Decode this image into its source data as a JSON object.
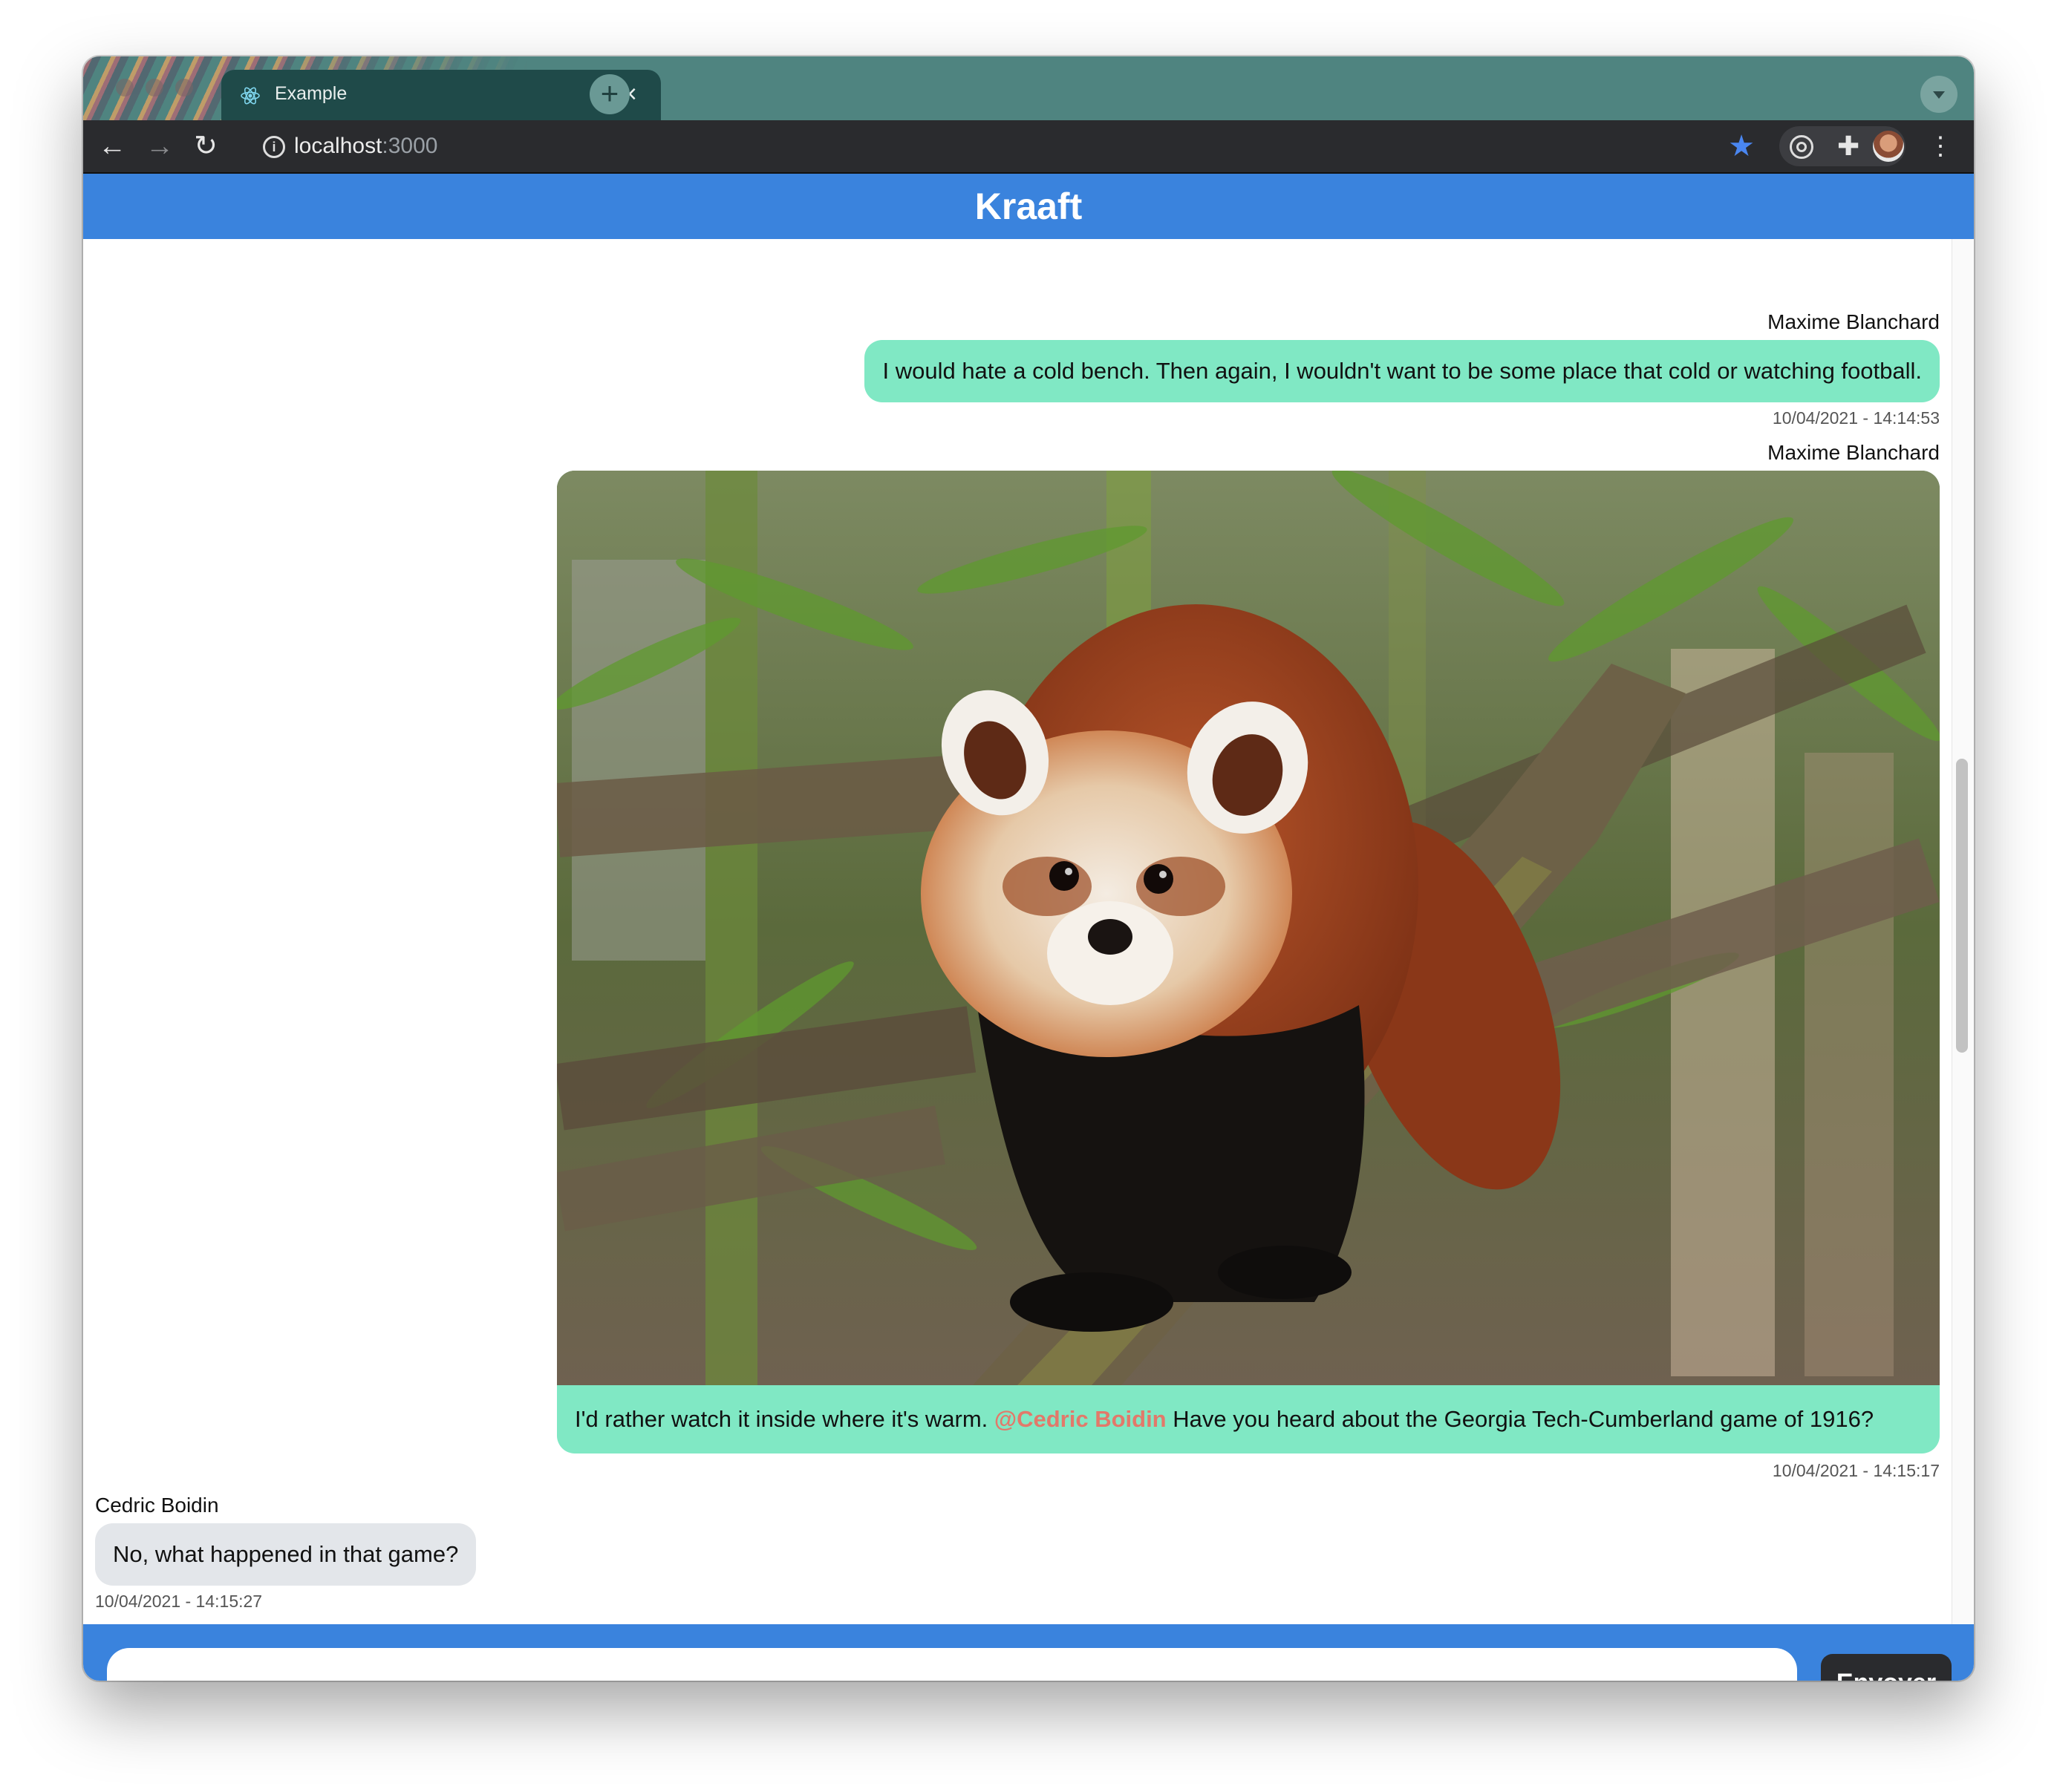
{
  "browser": {
    "tab_title": "Example",
    "url_host": "localhost",
    "url_port": ":3000"
  },
  "app": {
    "title": "Kraaft"
  },
  "messages": [
    {
      "author": "Maxime Blanchard",
      "text": "I would hate a cold bench. Then again, I wouldn't want to be some place that cold or watching football.",
      "time": "10/04/2021 - 14:14:53",
      "side": "right"
    },
    {
      "author": "Maxime Blanchard",
      "image": "red-panda-photo",
      "text_before": "I'd rather watch it inside where it's warm. ",
      "mention": "@Cedric Boidin",
      "text_after": " Have you heard about the Georgia Tech-Cumberland game of 1916?",
      "time": "10/04/2021 - 14:15:17",
      "side": "right"
    },
    {
      "author": "Cedric Boidin",
      "text": "No, what happened in that game?",
      "time": "10/04/2021 - 14:15:27",
      "side": "left"
    }
  ],
  "composer": {
    "placeholder": "",
    "send_label": "Envoyer"
  },
  "colors": {
    "header": "#3a83dd",
    "my_bubble": "#80e8c4",
    "their_bubble": "#e3e6ea",
    "mention": "#e2796a",
    "send_button": "#2a2b2e"
  }
}
